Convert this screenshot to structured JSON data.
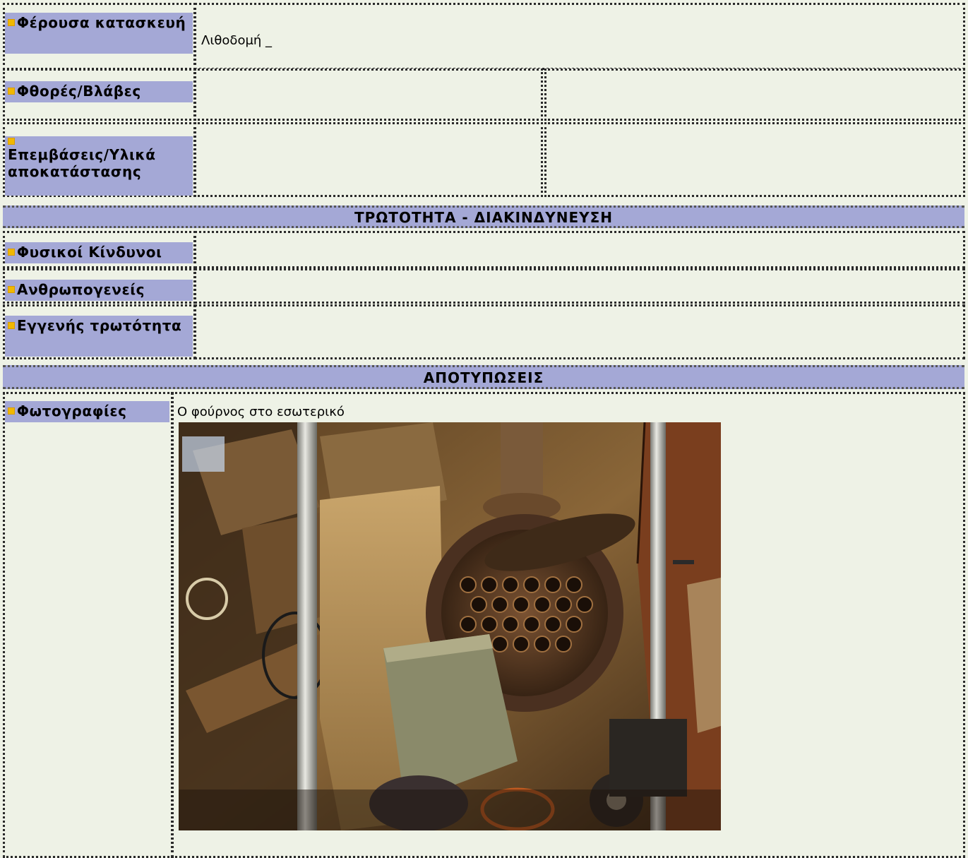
{
  "rows": {
    "bearing_structure": {
      "label": "Φέρουσα κατασκευή",
      "value": "Λιθοδομή _"
    },
    "damages": {
      "label": "Φθορές/Βλάβες",
      "value_left": "",
      "value_right": ""
    },
    "interventions": {
      "label": "Επεμβάσεις/Υλικά αποκατάστασης",
      "value_left": "",
      "value_right": ""
    },
    "natural_hazards": {
      "label": "Φυσικοί Κίνδυνοι",
      "value": ""
    },
    "anthropogenic": {
      "label": "Ανθρωπογενείς",
      "value": ""
    },
    "inherent_vulnerability": {
      "label": "Εγγενής τρωτότητα",
      "value": ""
    },
    "photographs": {
      "label": "Φωτογραφίες",
      "caption": "Ο φούρνος στο εσωτερικό"
    }
  },
  "sections": {
    "vulnerability": "ΤΡΩΤΟΤΗΤΑ - ΔΙΑΚΙΝΔΥΝΕΥΣΗ",
    "imprints": "ΑΠΟΤΥΠΩΣΕΙΣ"
  },
  "colors": {
    "label_bg": "#a4a8d6",
    "page_bg": "#eef2e6",
    "bullet": "#f0b800"
  },
  "icons": {
    "bullet": "bullet-square-icon"
  }
}
